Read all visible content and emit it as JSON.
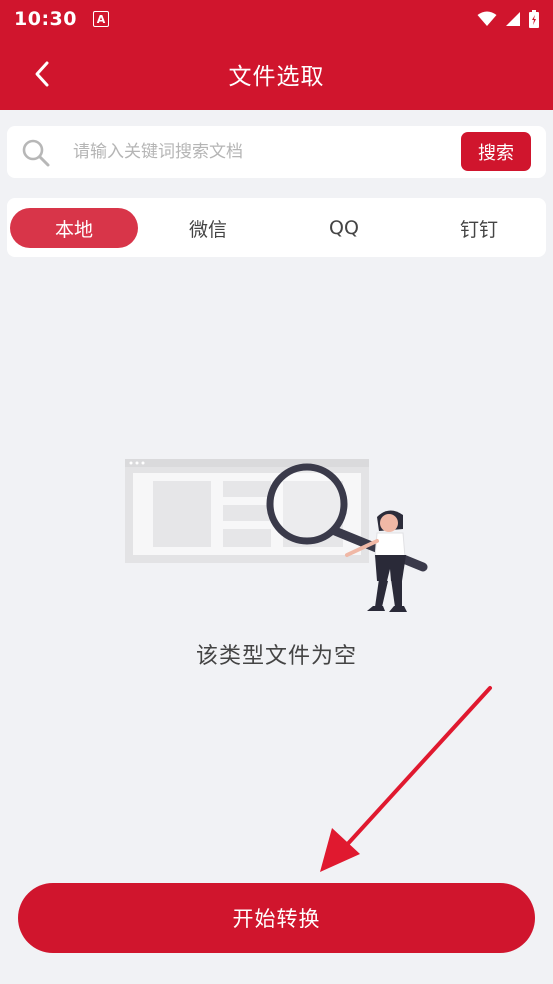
{
  "status_bar": {
    "time": "10:30",
    "notification_glyph": "A",
    "icons": [
      "wifi-icon",
      "signal-icon",
      "battery-icon"
    ]
  },
  "header": {
    "title": "文件选取",
    "back_icon": "chevron-left-icon"
  },
  "search": {
    "placeholder": "请输入关键词搜索文档",
    "value": "",
    "button_label": "搜索",
    "icon": "search-icon"
  },
  "tabs": [
    {
      "label": "本地",
      "active": true
    },
    {
      "label": "微信",
      "active": false
    },
    {
      "label": "QQ",
      "active": false
    },
    {
      "label": "钉钉",
      "active": false
    }
  ],
  "empty_state": {
    "message": "该类型文件为空",
    "illustration": "magnifier-person-illustration"
  },
  "annotation": {
    "icon": "red-arrow-icon"
  },
  "primary_action": {
    "label": "开始转换"
  },
  "colors": {
    "brand": "#d0152d",
    "active_tab": "#d83549",
    "background": "#f1f2f5"
  }
}
